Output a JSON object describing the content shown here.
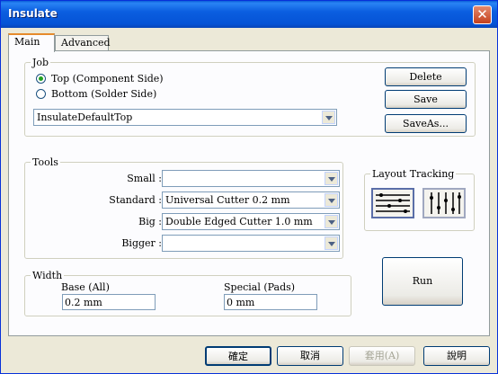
{
  "window": {
    "title": "Insulate",
    "close_glyph": "✕"
  },
  "tabs": [
    {
      "label": "Main"
    },
    {
      "label": "Advanced"
    }
  ],
  "job": {
    "legend": "Job",
    "radio_top": "Top (Component Side)",
    "radio_bottom": "Bottom (Solder Side)",
    "selected": "top",
    "preset_value": "InsulateDefaultTop",
    "delete_label": "Delete",
    "save_label": "Save",
    "saveas_label": "SaveAs..."
  },
  "tools": {
    "legend": "Tools",
    "small_label": "Small :",
    "small_value": "",
    "standard_label": "Standard :",
    "standard_value": "Universal Cutter 0.2 mm",
    "big_label": "Big :",
    "big_value": "Double Edged Cutter 1.0 mm",
    "bigger_label": "Bigger :",
    "bigger_value": ""
  },
  "layout_tracking": {
    "legend": "Layout Tracking",
    "icons": [
      "horizontal-tracking-icon",
      "vertical-tracking-icon"
    ]
  },
  "width": {
    "legend": "Width",
    "base_label": "Base (All)",
    "base_value": "0.2 mm",
    "special_label": "Special (Pads)",
    "special_value": "0 mm"
  },
  "run_label": "Run",
  "footer": {
    "ok_label": "確定",
    "cancel_label": "取消",
    "apply_label": "套用(A)",
    "help_label": "說明"
  }
}
